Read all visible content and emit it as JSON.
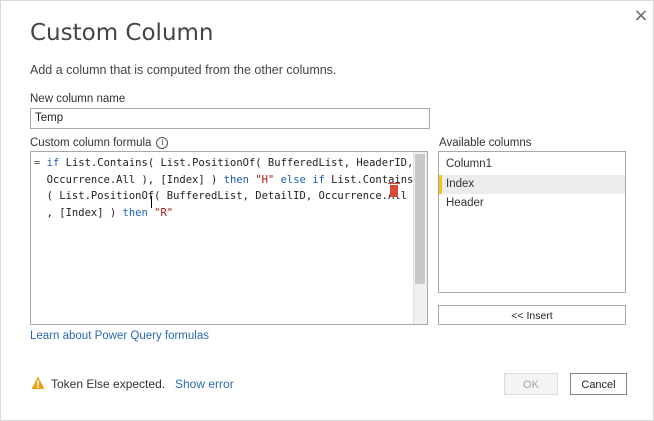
{
  "dialog": {
    "title": "Custom Column",
    "subtitle": "Add a column that is computed from the other columns.",
    "close_glyph": "×"
  },
  "name_field": {
    "label": "New column name",
    "value": "Temp"
  },
  "formula": {
    "label": "Custom column formula",
    "info_glyph": "i",
    "lines": [
      [
        {
          "t": "= ",
          "c": "op"
        },
        {
          "t": "if",
          "c": "kw"
        },
        {
          "t": " List.Contains( List.PositionOf( BufferedList, HeaderID,",
          "c": ""
        }
      ],
      [
        {
          "t": "  Occurrence.All ), [Index] ) ",
          "c": ""
        },
        {
          "t": "then",
          "c": "kw"
        },
        {
          "t": " ",
          "c": ""
        },
        {
          "t": "\"H\"",
          "c": "str"
        },
        {
          "t": " ",
          "c": ""
        },
        {
          "t": "else",
          "c": "kw"
        },
        {
          "t": " ",
          "c": ""
        },
        {
          "t": "if",
          "c": "kw"
        },
        {
          "t": " List.Contains",
          "c": ""
        }
      ],
      [
        {
          "t": "  ( List.PositionOf( BufferedList, DetailID, Occurrence.All )",
          "c": ""
        }
      ],
      [
        {
          "t": "  , [Index] ) ",
          "c": ""
        },
        {
          "t": "then",
          "c": "kw"
        },
        {
          "t": " ",
          "c": ""
        },
        {
          "t": "\"R\"",
          "c": "str"
        }
      ]
    ]
  },
  "available_columns": {
    "label": "Available columns",
    "items": [
      "Column1",
      "Index",
      "Header"
    ],
    "selected_index": 1,
    "insert_label": "<< Insert"
  },
  "learn_link": "Learn about Power Query formulas",
  "status": {
    "message": "Token Else expected.",
    "show_error_label": "Show error",
    "warning_color": "#e8a317"
  },
  "buttons": {
    "ok_label": "OK",
    "cancel_label": "Cancel"
  }
}
